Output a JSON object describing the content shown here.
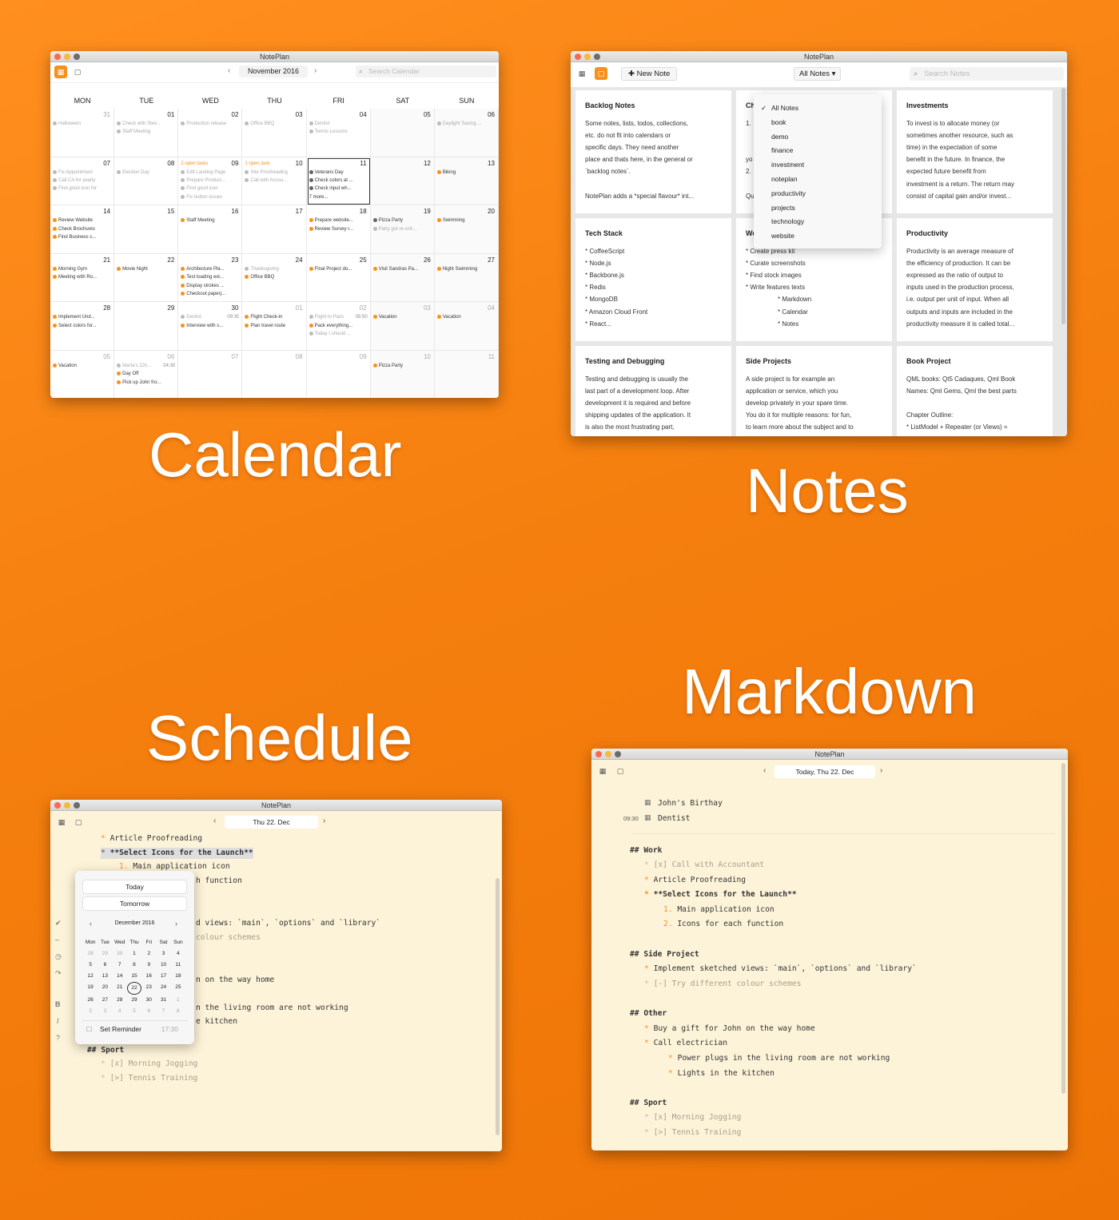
{
  "captions": {
    "calendar": "Calendar",
    "notes": "Notes",
    "schedule": "Schedule",
    "markdown": "Markdown"
  },
  "calendar": {
    "title": "NotePlan",
    "month": "November 2016",
    "search_placeholder": "Search Calendar",
    "weekdays": [
      "MON",
      "TUE",
      "WED",
      "THU",
      "FRI",
      "SAT",
      "SUN"
    ],
    "weeks": [
      [
        {
          "d": "31",
          "other": true,
          "events": [
            {
              "t": "Halloween",
              "c": "gray"
            }
          ]
        },
        {
          "d": "01",
          "events": [
            {
              "t": "Check with Stev...",
              "c": "gray"
            },
            {
              "t": "Staff Meeting",
              "c": "gray"
            }
          ]
        },
        {
          "d": "02",
          "events": [
            {
              "t": "Production release",
              "c": "gray"
            }
          ]
        },
        {
          "d": "03",
          "events": [
            {
              "t": "Office BBQ",
              "c": "gray"
            }
          ]
        },
        {
          "d": "04",
          "events": [
            {
              "t": "Dentist",
              "c": "gray"
            },
            {
              "t": "Tennis Lessons",
              "c": "gray"
            }
          ]
        },
        {
          "d": "05",
          "weekend": true,
          "events": []
        },
        {
          "d": "06",
          "weekend": true,
          "events": [
            {
              "t": "Daylight Saving ...",
              "c": "gray"
            }
          ]
        }
      ],
      [
        {
          "d": "07",
          "events": [
            {
              "t": "Fix Appointment",
              "c": "gray"
            },
            {
              "t": "Call CA for yearly",
              "c": "gray"
            },
            {
              "t": "Find good icon for",
              "c": "gray"
            }
          ]
        },
        {
          "d": "08",
          "events": [
            {
              "t": "Election Day",
              "c": "gray"
            }
          ]
        },
        {
          "d": "09",
          "note": "2 open tasks",
          "events": [
            {
              "t": "Edit Landing Page",
              "c": "gray"
            },
            {
              "t": "Prepare Product...",
              "c": "gray"
            },
            {
              "t": "Find good icon",
              "c": "gray"
            },
            {
              "t": "Fix button issues",
              "c": "gray"
            }
          ]
        },
        {
          "d": "10",
          "note": "1 open task",
          "events": [
            {
              "t": "Site Proofreading",
              "c": "gray"
            },
            {
              "t": "Call with Accou...",
              "c": "gray"
            }
          ]
        },
        {
          "d": "11",
          "today": true,
          "events": [
            {
              "t": "Veterans Day",
              "c": "dark"
            },
            {
              "t": "Check colors at ...",
              "c": "dark"
            },
            {
              "t": "Check input wh...",
              "c": "dark"
            },
            {
              "t": "7 more...",
              "c": "none"
            }
          ]
        },
        {
          "d": "12",
          "weekend": true,
          "events": []
        },
        {
          "d": "13",
          "weekend": true,
          "events": [
            {
              "t": "Biking",
              "c": "orange"
            }
          ]
        }
      ],
      [
        {
          "d": "14",
          "events": [
            {
              "t": "Review Website",
              "c": "orange"
            },
            {
              "t": "Check Brochures",
              "c": "orange"
            },
            {
              "t": "Find Business c...",
              "c": "orange"
            }
          ]
        },
        {
          "d": "15",
          "events": []
        },
        {
          "d": "16",
          "events": [
            {
              "t": "Staff Meeting",
              "c": "orange"
            }
          ]
        },
        {
          "d": "17",
          "events": []
        },
        {
          "d": "18",
          "events": [
            {
              "t": "Prepare website...",
              "c": "orange"
            },
            {
              "t": "Review Survey r...",
              "c": "orange"
            }
          ]
        },
        {
          "d": "19",
          "weekend": true,
          "events": [
            {
              "t": "Pizza Party",
              "c": "dark"
            },
            {
              "t": "Party got re-sch...",
              "c": "gray"
            }
          ]
        },
        {
          "d": "20",
          "weekend": true,
          "events": [
            {
              "t": "Swimming",
              "c": "orange"
            }
          ]
        }
      ],
      [
        {
          "d": "21",
          "events": [
            {
              "t": "Morning Gym",
              "c": "orange"
            },
            {
              "t": "Meeting with Ro...",
              "c": "orange"
            }
          ]
        },
        {
          "d": "22",
          "events": [
            {
              "t": "Movie Night",
              "c": "orange"
            }
          ]
        },
        {
          "d": "23",
          "events": [
            {
              "t": "Architecture Pla...",
              "c": "orange"
            },
            {
              "t": "Test loading ext...",
              "c": "orange"
            },
            {
              "t": "Display strokes ...",
              "c": "orange"
            },
            {
              "t": "Checkout paperj...",
              "c": "orange"
            }
          ]
        },
        {
          "d": "24",
          "events": [
            {
              "t": "Thanksgiving",
              "c": "gray"
            },
            {
              "t": "Office BBQ",
              "c": "orange"
            }
          ]
        },
        {
          "d": "25",
          "events": [
            {
              "t": "Final Project do...",
              "c": "orange"
            }
          ]
        },
        {
          "d": "26",
          "weekend": true,
          "events": [
            {
              "t": "Visit Sandras Pa...",
              "c": "orange"
            }
          ]
        },
        {
          "d": "27",
          "weekend": true,
          "events": [
            {
              "t": "Night Swimming",
              "c": "orange"
            }
          ]
        }
      ],
      [
        {
          "d": "28",
          "events": [
            {
              "t": "Implement Und...",
              "c": "orange"
            },
            {
              "t": "Select colors for...",
              "c": "orange"
            }
          ]
        },
        {
          "d": "29",
          "events": []
        },
        {
          "d": "30",
          "events": [
            {
              "t": "Dentist",
              "c": "gray",
              "time": "09:30"
            },
            {
              "t": "Interview with s...",
              "c": "orange"
            }
          ]
        },
        {
          "d": "01",
          "other": true,
          "events": [
            {
              "t": "Flight Check-in",
              "c": "orange"
            },
            {
              "t": "Plan travel route",
              "c": "orange"
            }
          ]
        },
        {
          "d": "02",
          "other": true,
          "events": [
            {
              "t": "Flight to Paris",
              "c": "gray",
              "time": "05:50"
            },
            {
              "t": "Pack everything...",
              "c": "orange"
            },
            {
              "t": "Today I should ...",
              "c": "gray"
            }
          ]
        },
        {
          "d": "03",
          "other": true,
          "weekend": true,
          "events": [
            {
              "t": "Vacation",
              "c": "orange"
            }
          ]
        },
        {
          "d": "04",
          "other": true,
          "weekend": true,
          "events": [
            {
              "t": "Vacation",
              "c": "orange"
            }
          ]
        }
      ],
      [
        {
          "d": "05",
          "other": true,
          "events": [
            {
              "t": "Vacation",
              "c": "orange"
            }
          ]
        },
        {
          "d": "06",
          "other": true,
          "events": [
            {
              "t": "Marta's 22n...",
              "c": "gray",
              "time": "04:30"
            },
            {
              "t": "Day Off",
              "c": "orange"
            },
            {
              "t": "Pick up John fro...",
              "c": "orange"
            }
          ]
        },
        {
          "d": "07",
          "other": true,
          "events": []
        },
        {
          "d": "08",
          "other": true,
          "events": []
        },
        {
          "d": "09",
          "other": true,
          "events": []
        },
        {
          "d": "10",
          "other": true,
          "weekend": true,
          "events": [
            {
              "t": "Pizza Party",
              "c": "orange"
            }
          ]
        },
        {
          "d": "11",
          "other": true,
          "weekend": true,
          "events": []
        }
      ]
    ]
  },
  "notes": {
    "title": "NotePlan",
    "new_note": "New Note",
    "filter": "All Notes",
    "search_placeholder": "Search Notes",
    "dropdown": [
      "All Notes",
      "book",
      "demo",
      "finance",
      "investment",
      "noteplan",
      "productivity",
      "projects",
      "technology",
      "website"
    ],
    "cards": [
      {
        "title": "Backlog Notes",
        "body": "Some notes, lists, todos, collections,\netc. do not fit into calendars or\nspecific days. They need another\nplace and thats here, in the general or\n`backlog notes`.\n\nNotePlan adds a *special flavour* int..."
      },
      {
        "title": "Ch",
        "body": "1.\n\n\nyo\n2.\n\nQu"
      },
      {
        "title": "Investments",
        "body": "To invest is to allocate money (or\nsometimes another resource, such as\ntime) in the expectation of some\nbenefit in the future. In finance, the\nexpected future benefit from\ninvestment is a return. The return may\nconsist of capital gain and/or invest..."
      },
      {
        "title": "Tech Stack",
        "body": "* CoffeeScript\n* Node.js\n* Backbone.js\n* Redis\n* MongoDB\n* Amazon Cloud Front\n* React..."
      },
      {
        "title": "We",
        "body": "* Create press kit\n* Curate screenshots\n* Find stock images\n* Write features texts\n                  * Markdown\n                  * Calendar\n                  * Notes"
      },
      {
        "title": "Productivity",
        "body": "Productivity is an average measure of\nthe efficiency of production. It can be\nexpressed as the ratio of output to\ninputs used in the production process,\ni.e. output per unit of input. When all\noutputs and inputs are included in the\nproductivity measure it is called total..."
      },
      {
        "title": "Testing and Debugging",
        "body": "Testing and debugging is usually the\nlast part of a development loop. After\ndevelopment it is required and before\nshipping updates of the application. It\nis also the most frustrating part,"
      },
      {
        "title": "Side Projects",
        "body": "A side project is for example an\napplication or service, which you\ndevelop privately in your spare time.\nYou do it for multiple reasons: for fun,\nto learn more about the subject and to"
      },
      {
        "title": "Book Project",
        "body": "QML books: Qt5 Cadaques, Qml Book\nNames: Qml Gems, Qml the best parts\n\nChapter Outline:\n* ListModel + Repeater (or Views) ="
      }
    ]
  },
  "schedule": {
    "title": "NotePlan",
    "date": "Thu 22. Dec",
    "lines": {
      "l1": "Article Proofreading",
      "l2": "**Select Icons for the Launch**",
      "l3_num": "1.",
      "l3": "Main application icon",
      "l4": "h function",
      "l5": "d views: `main`, `options` and `library`",
      "l6": "colour schemes",
      "l7": "n on the way home",
      "l8": "n the living room are not working",
      "l9": "e kitchen",
      "l10": "## Sport",
      "l11": "[x] Morning Jogging",
      "l12": "[>] Tennis Training"
    },
    "popover": {
      "today": "Today",
      "tomorrow": "Tomorrow",
      "month": "December 2016",
      "weekdays": [
        "Mon",
        "Tue",
        "Wed",
        "Thu",
        "Fri",
        "Sat",
        "Sun"
      ],
      "days": [
        {
          "d": "28",
          "o": true
        },
        {
          "d": "29",
          "o": true
        },
        {
          "d": "30",
          "o": true
        },
        {
          "d": "1"
        },
        {
          "d": "2"
        },
        {
          "d": "3"
        },
        {
          "d": "4"
        },
        {
          "d": "5"
        },
        {
          "d": "6"
        },
        {
          "d": "7"
        },
        {
          "d": "8"
        },
        {
          "d": "9"
        },
        {
          "d": "10"
        },
        {
          "d": "11"
        },
        {
          "d": "12"
        },
        {
          "d": "13"
        },
        {
          "d": "14"
        },
        {
          "d": "15"
        },
        {
          "d": "16"
        },
        {
          "d": "17"
        },
        {
          "d": "18"
        },
        {
          "d": "19"
        },
        {
          "d": "20"
        },
        {
          "d": "21"
        },
        {
          "d": "22",
          "sel": true
        },
        {
          "d": "23"
        },
        {
          "d": "24"
        },
        {
          "d": "25"
        },
        {
          "d": "26"
        },
        {
          "d": "27"
        },
        {
          "d": "28"
        },
        {
          "d": "29"
        },
        {
          "d": "30"
        },
        {
          "d": "31"
        },
        {
          "d": "1",
          "o": true
        },
        {
          "d": "2",
          "o": true
        },
        {
          "d": "3",
          "o": true
        },
        {
          "d": "4",
          "o": true
        },
        {
          "d": "5",
          "o": true
        },
        {
          "d": "6",
          "o": true
        },
        {
          "d": "7",
          "o": true
        },
        {
          "d": "8",
          "o": true
        }
      ],
      "reminder": "Set Reminder",
      "time": "17:30"
    }
  },
  "markdown": {
    "title": "NotePlan",
    "date": "Today, Thu 22. Dec",
    "birthday": "John's Birthay",
    "dentist_time": "09:30",
    "dentist": "Dentist",
    "lines": {
      "work": "## Work",
      "w1": "[x] Call with Accountant",
      "w2": "Article Proofreading",
      "w3": "**Select Icons for the Launch**",
      "w4": "Main application icon",
      "w5": "Icons for each function",
      "side": "## Side Project",
      "s1": "Implement sketched views: `main`, `options` and `library`",
      "s2": "[-] Try different colour schemes",
      "other": "## Other",
      "o1": "Buy a gift for John on the way home",
      "o2": "Call electrician",
      "o3": "Power plugs in the living room are not working",
      "o4": "Lights in the kitchen",
      "sport": "## Sport",
      "sp1": "[x] Morning Jogging",
      "sp2": "[>] Tennis Training"
    }
  }
}
